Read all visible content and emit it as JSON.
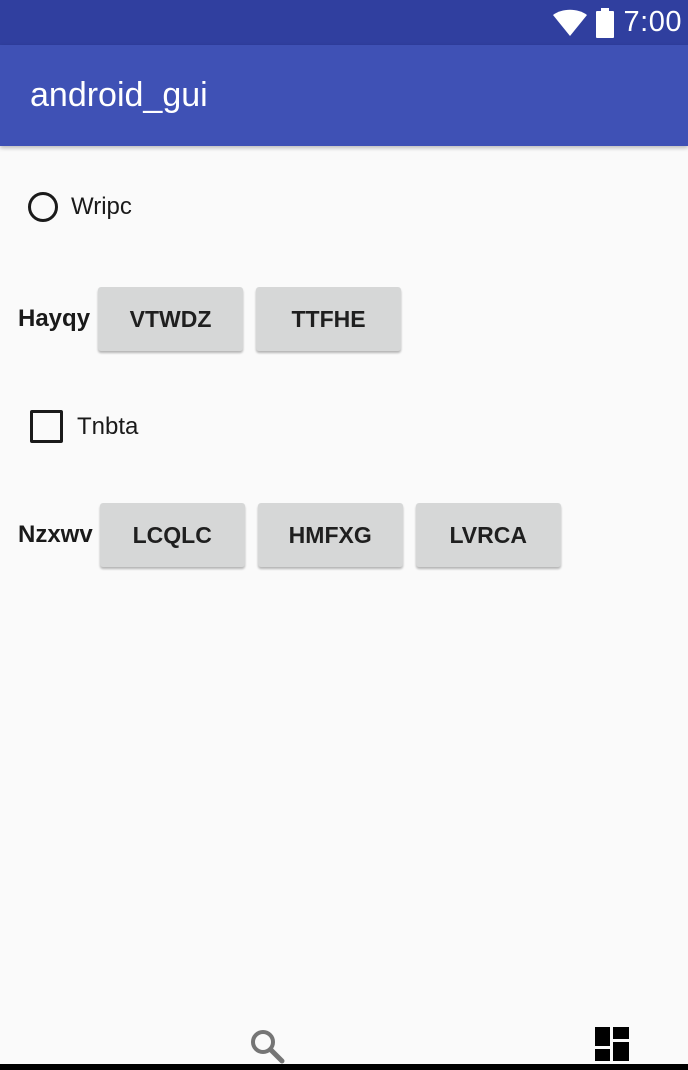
{
  "status_bar": {
    "time": "7:00",
    "icons": [
      "wifi-icon",
      "battery-icon"
    ]
  },
  "app_bar": {
    "title": "android_gui"
  },
  "radio": {
    "label": "Wripc",
    "checked": false
  },
  "row1": {
    "label": "Hayqy",
    "buttons": [
      "VTWDZ",
      "TTFHE"
    ]
  },
  "checkbox": {
    "label": "Tnbta",
    "checked": false
  },
  "row2": {
    "label": "Nzxwv",
    "buttons": [
      "LCQLC",
      "HMFXG",
      "LVRCA"
    ]
  },
  "bottom_bar": {
    "icons": [
      "search-icon",
      "dashboard-icon"
    ]
  },
  "colors": {
    "status_bar": "#303f9f",
    "app_bar": "#3f51b5",
    "background": "#fafafa",
    "button": "#d6d7d7"
  }
}
